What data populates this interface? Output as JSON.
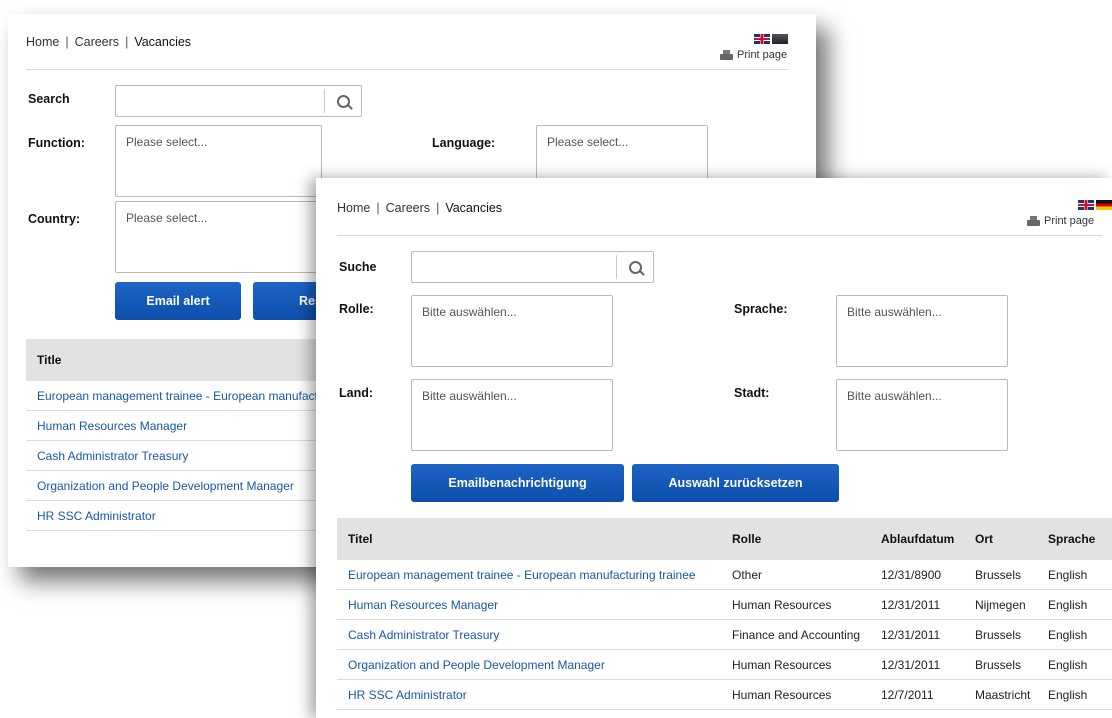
{
  "english": {
    "breadcrumb": [
      "Home",
      "Careers",
      "Vacancies"
    ],
    "print_label": "Print page",
    "search_label": "Search",
    "function_label": "Function:",
    "language_label": "Language:",
    "country_label": "Country:",
    "function_placeholder": "Please select...",
    "language_placeholder": "Please select...",
    "country_placeholder": "Please select...",
    "email_alert_button": "Email alert",
    "reset_button": "Reset",
    "table_header_title": "Title",
    "rows": [
      "European management trainee - European manufacturing trainee",
      "Human Resources Manager",
      "Cash Administrator Treasury",
      "Organization and People Development Manager",
      "HR SSC Administrator"
    ]
  },
  "german": {
    "breadcrumb": [
      "Home",
      "Careers",
      "Vacancies"
    ],
    "print_label": "Print page",
    "search_label": "Suche",
    "rolle_label": "Rolle:",
    "sprache_label": "Sprache:",
    "land_label": "Land:",
    "stadt_label": "Stadt:",
    "rolle_placeholder": "Bitte auswählen...",
    "sprache_placeholder": "Bitte auswählen...",
    "land_placeholder": "Bitte auswählen...",
    "stadt_placeholder": "Bitte auswählen...",
    "email_button": "Emailbenachrichtigung",
    "reset_button": "Auswahl zurücksetzen",
    "headers": [
      "Titel",
      "Rolle",
      "Ablaufdatum",
      "Ort",
      "Sprache"
    ],
    "rows": [
      {
        "title": "European management trainee - European manufacturing trainee",
        "rolle": "Other",
        "date": "12/31/8900",
        "ort": "Brussels",
        "sprache": "English"
      },
      {
        "title": "Human Resources Manager",
        "rolle": "Human Resources",
        "date": "12/31/2011",
        "ort": "Nijmegen",
        "sprache": "English"
      },
      {
        "title": "Cash Administrator Treasury",
        "rolle": "Finance and Accounting",
        "date": "12/31/2011",
        "ort": "Brussels",
        "sprache": "English"
      },
      {
        "title": "Organization and People Development Manager",
        "rolle": "Human Resources",
        "date": "12/31/2011",
        "ort": "Brussels",
        "sprache": "English"
      },
      {
        "title": "HR SSC Administrator",
        "rolle": "Human Resources",
        "date": "12/7/2011",
        "ort": "Maastricht",
        "sprache": "English"
      }
    ]
  },
  "colors": {
    "link": "#1a57a8",
    "button": "#1559bb",
    "header_bg": "#e2e2e2"
  },
  "icons": [
    "uk-flag-icon",
    "language-flag-icon",
    "german-flag-icon",
    "printer-icon",
    "search-icon"
  ]
}
